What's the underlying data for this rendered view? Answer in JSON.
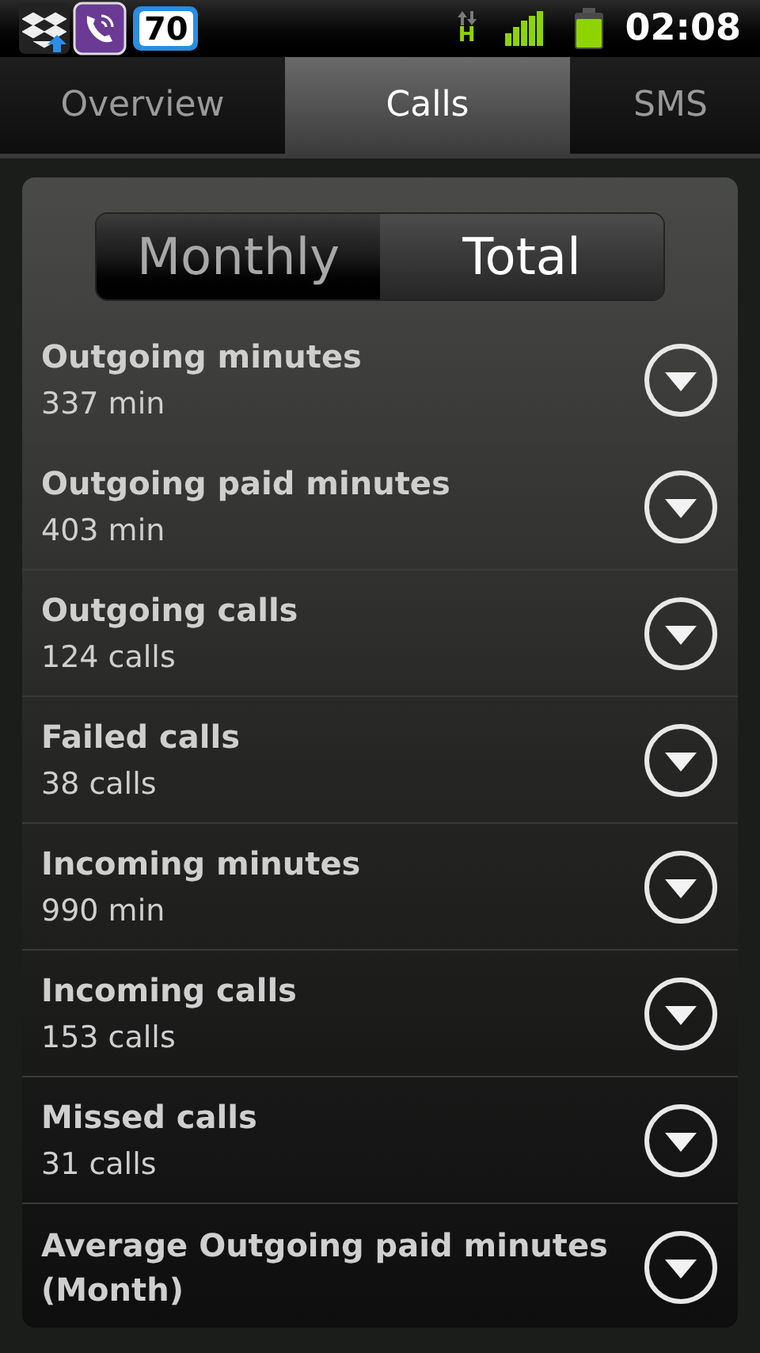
{
  "status_bar": {
    "notification_badge": "70",
    "network_type": "H",
    "time": "02:08"
  },
  "tabs": [
    {
      "label": "Overview",
      "selected": false
    },
    {
      "label": "Calls",
      "selected": true
    },
    {
      "label": "SMS",
      "selected": false
    }
  ],
  "period_toggle": [
    {
      "label": "Monthly",
      "selected": false
    },
    {
      "label": "Total",
      "selected": true
    }
  ],
  "stats": [
    {
      "label": "Outgoing minutes",
      "value": "337 min"
    },
    {
      "label": "Outgoing paid minutes",
      "value": "403 min"
    },
    {
      "label": "Outgoing calls",
      "value": "124 calls"
    },
    {
      "label": "Failed calls",
      "value": "38 calls"
    },
    {
      "label": "Incoming minutes",
      "value": "990 min"
    },
    {
      "label": "Incoming calls",
      "value": "153 calls"
    },
    {
      "label": "Missed calls",
      "value": "31 calls"
    },
    {
      "label": "Average Outgoing paid minutes (Month)"
    }
  ]
}
